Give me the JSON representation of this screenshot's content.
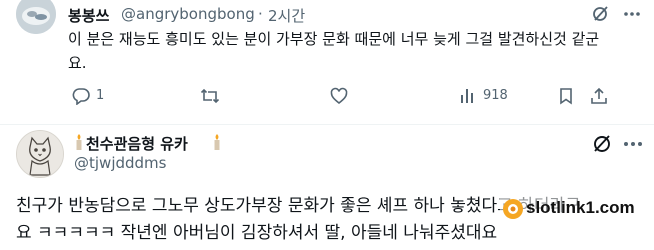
{
  "tweet1": {
    "name": "봉봉쓰",
    "handle": "@angrybongbong",
    "dot": "·",
    "time": "2시간",
    "text_line1": "이 분은 재능도 흥미도 있는 분이 가부장 문화 때문에 너무 늦게 그걸 발견하신것 같군",
    "text_line2": "요.",
    "reply_count": "1",
    "views_count": "918"
  },
  "tweet2": {
    "name": "천수관음형 유카",
    "handle": "@tjwjdddms",
    "text_line1": "친구가 반농담으로 그노무 상도가부장 문화가 좋은 셰프 하나 놓쳤다고 하더라구",
    "text_line2": "요 ㅋㅋㅋㅋㅋ 작년엔 아버님이 김장하셔서 딸, 아들네 나눠주셨대요"
  },
  "watermark": {
    "text": "slotlink1.com"
  },
  "colors": {
    "text": "#0f1419",
    "secondary": "#536471",
    "divider": "#eff3f4"
  }
}
